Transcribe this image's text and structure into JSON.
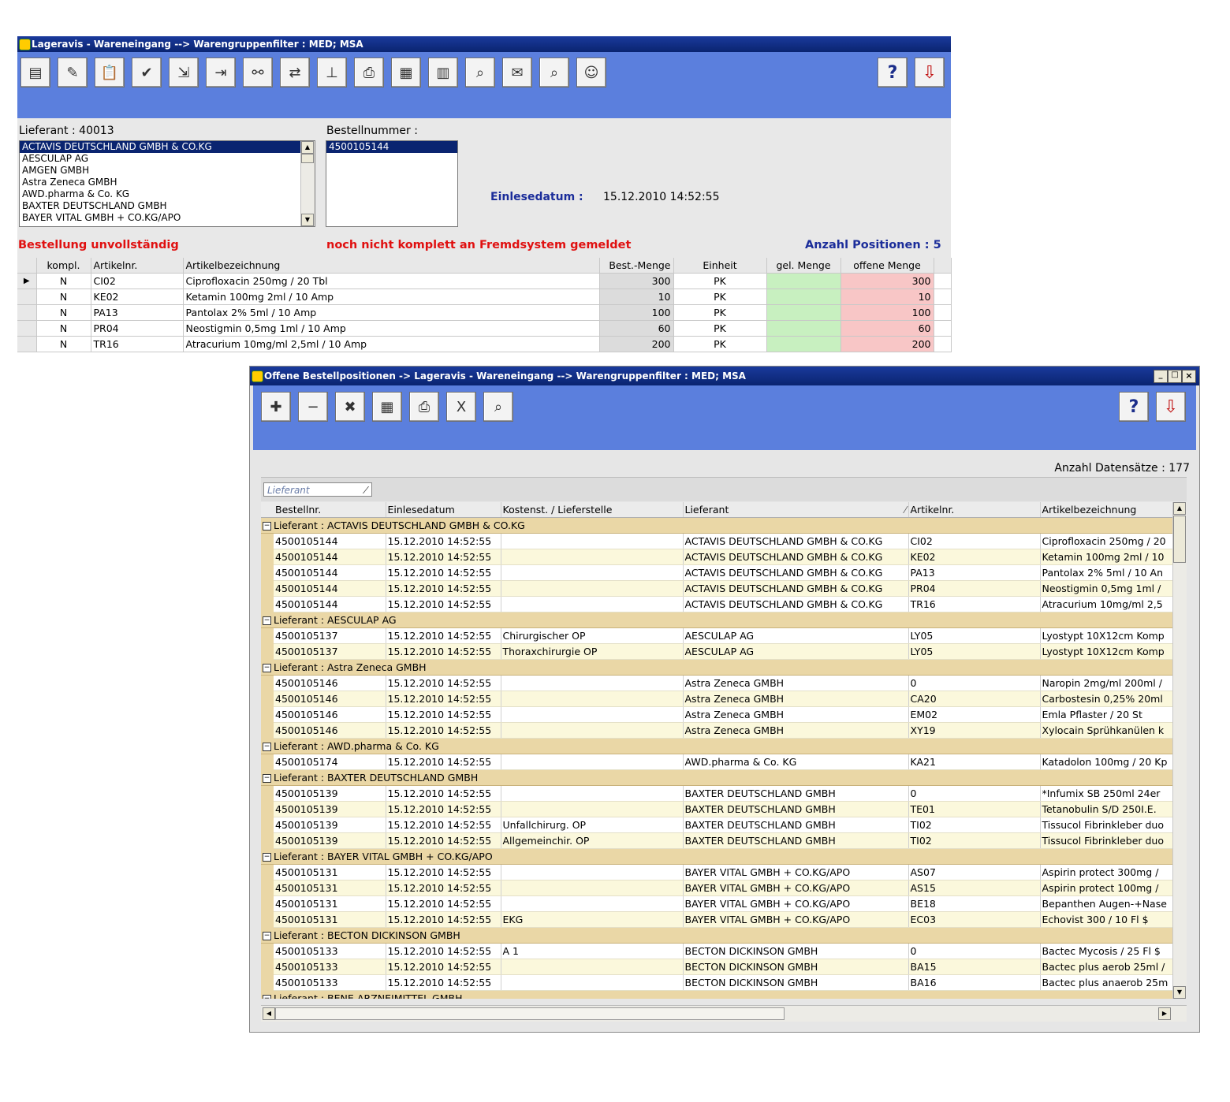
{
  "win1": {
    "title": "Lageravis - Wareneingang --> Warengruppenfilter : MED; MSA",
    "toolbar_icons": [
      "properties-icon",
      "edit-list-icon",
      "clipboard-icon",
      "calc-check-icon",
      "calc-to-pc-icon",
      "pc-to-calc-icon",
      "binoculars-icon",
      "transfer-icon",
      "hierarchy-icon",
      "printer-icon",
      "grid-icon",
      "grid-export-icon",
      "zoom-page-icon",
      "document-stamp-icon",
      "zoom-document-icon",
      "users-icon"
    ],
    "help_label": "?",
    "lieferant_label": "Lieferant :",
    "lieferant_value": "40013",
    "bestellnummer_label": "Bestellnummer :",
    "suppliers": [
      "ACTAVIS DEUTSCHLAND GMBH & CO.KG",
      "AESCULAP AG",
      "AMGEN GMBH",
      "Astra Zeneca GMBH",
      "AWD.pharma  & Co. KG",
      "BAXTER DEUTSCHLAND GMBH",
      "BAYER VITAL GMBH + CO.KG/APO"
    ],
    "orders": [
      "4500105144"
    ],
    "einlesedatum_label": "Einlesedatum :",
    "einlesedatum_value": "15.12.2010 14:52:55",
    "status_left": "Bestellung unvollständig",
    "status_mid": "noch nicht komplett an Fremdsystem gemeldet",
    "anzahl_label": "Anzahl Positionen :",
    "anzahl_value": "5",
    "columns": [
      "kompl.",
      "Artikelnr.",
      "Artikelbezeichnung",
      "Best.-Menge",
      "Einheit",
      "gel. Menge",
      "offene Menge"
    ],
    "rows": [
      {
        "kompl": "N",
        "artnr": "CI02",
        "bez": "Ciprofloxacin 250mg / 20 Tbl",
        "best": "300",
        "einheit": "PK",
        "gel": "",
        "offen": "300"
      },
      {
        "kompl": "N",
        "artnr": "KE02",
        "bez": "Ketamin 100mg 2ml / 10 Amp",
        "best": "10",
        "einheit": "PK",
        "gel": "",
        "offen": "10"
      },
      {
        "kompl": "N",
        "artnr": "PA13",
        "bez": "Pantolax 2% 5ml / 10 Amp",
        "best": "100",
        "einheit": "PK",
        "gel": "",
        "offen": "100"
      },
      {
        "kompl": "N",
        "artnr": "PR04",
        "bez": "Neostigmin 0,5mg 1ml / 10 Amp",
        "best": "60",
        "einheit": "PK",
        "gel": "",
        "offen": "60"
      },
      {
        "kompl": "N",
        "artnr": "TR16",
        "bez": "Atracurium 10mg/ml 2,5ml / 10 Amp",
        "best": "200",
        "einheit": "PK",
        "gel": "",
        "offen": "200"
      }
    ]
  },
  "win2": {
    "title": "Offene Bestellpositionen -> Lageravis - Wareneingang --> Warengruppenfilter : MED; MSA",
    "toolbar_icons": [
      "new-note-icon",
      "remove-note-icon",
      "delete-note-icon",
      "calculator-icon",
      "printer-icon",
      "excel-icon",
      "zoom-document-icon"
    ],
    "help_label": "?",
    "anzahl_label": "Anzahl Datensätze :",
    "anzahl_value": "177",
    "group_chip": "Lieferant",
    "columns": [
      "Bestellnr.",
      "Einlesedatum",
      "Kostenst. / Lieferstelle",
      "Lieferant",
      "Artikelnr.",
      "Artikelbezeichnung"
    ],
    "group_prefix": "Lieferant :",
    "groups": [
      {
        "name": "ACTAVIS DEUTSCHLAND GMBH & CO.KG",
        "rows": [
          [
            "4500105144",
            "15.12.2010 14:52:55",
            "",
            "ACTAVIS DEUTSCHLAND GMBH & CO.KG",
            "CI02",
            "Ciprofloxacin 250mg / 20"
          ],
          [
            "4500105144",
            "15.12.2010 14:52:55",
            "",
            "ACTAVIS DEUTSCHLAND GMBH & CO.KG",
            "KE02",
            "Ketamin 100mg 2ml / 10"
          ],
          [
            "4500105144",
            "15.12.2010 14:52:55",
            "",
            "ACTAVIS DEUTSCHLAND GMBH & CO.KG",
            "PA13",
            "Pantolax 2% 5ml / 10 An"
          ],
          [
            "4500105144",
            "15.12.2010 14:52:55",
            "",
            "ACTAVIS DEUTSCHLAND GMBH & CO.KG",
            "PR04",
            "Neostigmin 0,5mg 1ml /"
          ],
          [
            "4500105144",
            "15.12.2010 14:52:55",
            "",
            "ACTAVIS DEUTSCHLAND GMBH & CO.KG",
            "TR16",
            "Atracurium 10mg/ml 2,5"
          ]
        ]
      },
      {
        "name": "AESCULAP AG",
        "rows": [
          [
            "4500105137",
            "15.12.2010 14:52:55",
            "Chirurgischer OP",
            "AESCULAP AG",
            "LY05",
            "Lyostypt 10X12cm Komp"
          ],
          [
            "4500105137",
            "15.12.2010 14:52:55",
            "Thoraxchirurgie OP",
            "AESCULAP AG",
            "LY05",
            "Lyostypt 10X12cm Komp"
          ]
        ]
      },
      {
        "name": "Astra Zeneca GMBH",
        "rows": [
          [
            "4500105146",
            "15.12.2010 14:52:55",
            "",
            "Astra Zeneca GMBH",
            "0",
            "Naropin 2mg/ml 200ml /"
          ],
          [
            "4500105146",
            "15.12.2010 14:52:55",
            "",
            "Astra Zeneca GMBH",
            "CA20",
            "Carbostesin 0,25% 20ml"
          ],
          [
            "4500105146",
            "15.12.2010 14:52:55",
            "",
            "Astra Zeneca GMBH",
            "EM02",
            "Emla Pflaster / 20 St"
          ],
          [
            "4500105146",
            "15.12.2010 14:52:55",
            "",
            "Astra Zeneca GMBH",
            "XY19",
            "Xylocain Sprühkanülen k"
          ]
        ]
      },
      {
        "name": "AWD.pharma  & Co. KG",
        "rows": [
          [
            "4500105174",
            "15.12.2010 14:52:55",
            "",
            "AWD.pharma  & Co. KG",
            "KA21",
            "Katadolon 100mg / 20 Kp"
          ]
        ]
      },
      {
        "name": "BAXTER DEUTSCHLAND GMBH",
        "rows": [
          [
            "4500105139",
            "15.12.2010 14:52:55",
            "",
            "BAXTER DEUTSCHLAND GMBH",
            "0",
            "*Infumix SB 250ml 24er"
          ],
          [
            "4500105139",
            "15.12.2010 14:52:55",
            "",
            "BAXTER DEUTSCHLAND GMBH",
            "TE01",
            "Tetanobulin S/D 250I.E."
          ],
          [
            "4500105139",
            "15.12.2010 14:52:55",
            "Unfallchirurg. OP",
            "BAXTER DEUTSCHLAND GMBH",
            "TI02",
            "Tissucol Fibrinkleber duo"
          ],
          [
            "4500105139",
            "15.12.2010 14:52:55",
            "Allgemeinchir. OP",
            "BAXTER DEUTSCHLAND GMBH",
            "TI02",
            "Tissucol Fibrinkleber duo"
          ]
        ]
      },
      {
        "name": "BAYER VITAL GMBH + CO.KG/APO",
        "rows": [
          [
            "4500105131",
            "15.12.2010 14:52:55",
            "",
            "BAYER VITAL GMBH + CO.KG/APO",
            "AS07",
            "Aspirin protect 300mg /"
          ],
          [
            "4500105131",
            "15.12.2010 14:52:55",
            "",
            "BAYER VITAL GMBH + CO.KG/APO",
            "AS15",
            "Aspirin protect 100mg /"
          ],
          [
            "4500105131",
            "15.12.2010 14:52:55",
            "",
            "BAYER VITAL GMBH + CO.KG/APO",
            "BE18",
            "Bepanthen Augen-+Nase"
          ],
          [
            "4500105131",
            "15.12.2010 14:52:55",
            "EKG",
            "BAYER VITAL GMBH + CO.KG/APO",
            "EC03",
            "Echovist 300 / 10 Fl $"
          ]
        ]
      },
      {
        "name": "BECTON DICKINSON GMBH",
        "rows": [
          [
            "4500105133",
            "15.12.2010 14:52:55",
            "A 1",
            "BECTON DICKINSON GMBH",
            "0",
            "Bactec Mycosis / 25 Fl $"
          ],
          [
            "4500105133",
            "15.12.2010 14:52:55",
            "",
            "BECTON DICKINSON GMBH",
            "BA15",
            "Bactec plus aerob 25ml /"
          ],
          [
            "4500105133",
            "15.12.2010 14:52:55",
            "",
            "BECTON DICKINSON GMBH",
            "BA16",
            "Bactec plus anaerob 25m"
          ]
        ]
      },
      {
        "name": "BENE-ARZNEIMITTEL GMBH",
        "rows": []
      }
    ]
  }
}
